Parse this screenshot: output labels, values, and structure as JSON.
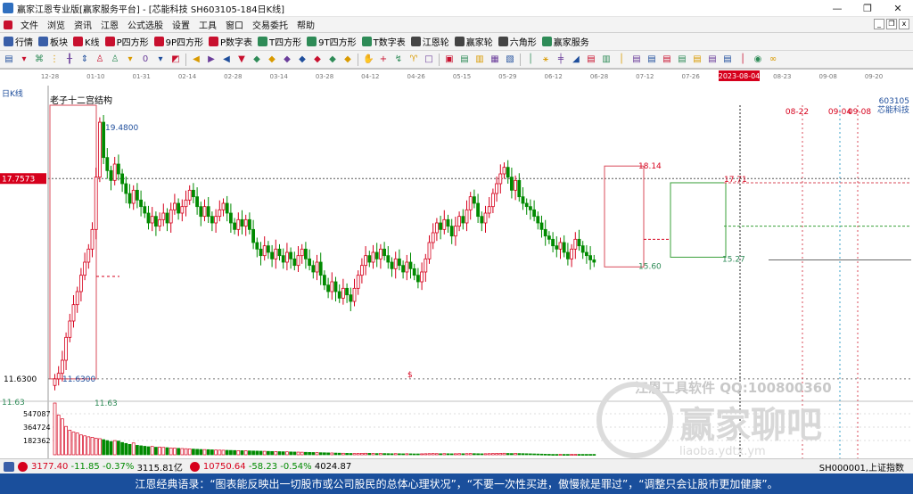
{
  "window": {
    "title": "赢家江恩专业版[赢家服务平台] - [芯能科技  SH603105-184日K线]",
    "controls": {
      "minimize": "—",
      "restore": "❐",
      "close": "✕"
    }
  },
  "menu": {
    "items": [
      "文件",
      "浏览",
      "资讯",
      "江恩",
      "公式选股",
      "设置",
      "工具",
      "窗口",
      "交易委托",
      "帮助"
    ],
    "right_controls": [
      "_",
      "❐",
      "x"
    ]
  },
  "toolbar": {
    "items": [
      {
        "label": "行情",
        "color": "#3a5fa8"
      },
      {
        "label": "板块",
        "color": "#3a5fa8"
      },
      {
        "label": "K线",
        "color": "#c8102e"
      },
      {
        "label": "P四方形",
        "color": "#c8102e"
      },
      {
        "label": "9P四方形",
        "color": "#c8102e"
      },
      {
        "label": "P数字表",
        "color": "#c8102e"
      },
      {
        "label": "T四方形",
        "color": "#2e8b57"
      },
      {
        "label": "9T四方形",
        "color": "#2e8b57"
      },
      {
        "label": "T数字表",
        "color": "#2e8b57"
      },
      {
        "label": "江恩轮",
        "color": "#444444"
      },
      {
        "label": "赢家轮",
        "color": "#444444"
      },
      {
        "label": "六角形",
        "color": "#444444"
      },
      {
        "label": "赢家服务",
        "color": "#2e8b57"
      }
    ]
  },
  "drawing_tools": [
    "▤",
    "▾",
    "⌘",
    "⋮",
    "╂",
    "⇕",
    "♙",
    "♙",
    "▾",
    "0",
    "▾",
    "◩",
    "|",
    "◀",
    "▶",
    "◀",
    "▼",
    "◆",
    "◆",
    "◆",
    "◆",
    "◆",
    "◆",
    "◆",
    "|",
    "✋",
    "+",
    "↯",
    "♈",
    "□",
    "|",
    "▣",
    "▤",
    "▥",
    "▦",
    "▧",
    "|",
    "│",
    "⚹",
    "╪",
    "◢",
    "▤",
    "▥",
    "│",
    "▤",
    "▤",
    "▤",
    "▤",
    "▤",
    "▤",
    "▤",
    "│",
    "◉",
    "∞"
  ],
  "chart_data": {
    "type": "candlestick",
    "period_label": "日K线",
    "stock_code": "603105",
    "stock_name": "芯能科技",
    "study_label": "老子十二宫结构",
    "x_dates": [
      "12-28",
      "01-10",
      "01-31",
      "02-14",
      "02-28",
      "03-14",
      "03-28",
      "04-12",
      "04-26",
      "05-15",
      "05-29",
      "06-12",
      "06-28",
      "07-12",
      "07-26",
      "2023-08-04",
      "08-23",
      "09-08",
      "09-20"
    ],
    "highlight_date": "2023-08-04",
    "future_markers": [
      "08-22",
      "09-04",
      "09-08"
    ],
    "price_high": 19.48,
    "price_low": 11.63,
    "cursor_price": "17.7573",
    "y_axis_labels": [
      "11.6300"
    ],
    "annotations": [
      "19.4800",
      "11.6300",
      "18.14",
      "17.71",
      "15.60",
      "15.27",
      "11.63",
      "$"
    ],
    "volume_labels": [
      "547087",
      "364724",
      "182362"
    ],
    "ylim": [
      11.0,
      20.0
    ],
    "closes": [
      11.63,
      11.8,
      12.2,
      12.9,
      13.4,
      13.9,
      14.3,
      14.8,
      15.2,
      15.6,
      16.2,
      17.8,
      19.48,
      18.4,
      18.0,
      17.7,
      18.2,
      17.9,
      17.6,
      17.3,
      17.0,
      17.4,
      17.1,
      16.9,
      16.7,
      16.4,
      16.6,
      16.3,
      16.5,
      16.7,
      16.4,
      16.8,
      17.0,
      16.7,
      16.9,
      17.1,
      17.4,
      17.2,
      16.9,
      16.6,
      16.9,
      16.6,
      16.4,
      16.6,
      16.8,
      17.0,
      16.7,
      16.4,
      16.2,
      16.5,
      16.3,
      16.5,
      16.2,
      15.8,
      15.6,
      15.4,
      15.7,
      15.5,
      15.3,
      15.6,
      15.4,
      15.2,
      15.5,
      15.3,
      15.1,
      15.4,
      15.6,
      15.3,
      15.1,
      14.9,
      15.2,
      14.8,
      14.5,
      14.3,
      14.6,
      14.3,
      14.1,
      14.4,
      14.2,
      14.0,
      14.4,
      14.8,
      15.1,
      15.4,
      15.2,
      15.5,
      15.3,
      15.6,
      15.4,
      15.2,
      15.0,
      15.3,
      15.1,
      14.9,
      15.2,
      15.0,
      14.8,
      14.6,
      14.9,
      15.3,
      15.8,
      16.1,
      16.4,
      16.2,
      16.5,
      16.3,
      16.0,
      16.3,
      16.6,
      16.4,
      16.8,
      17.2,
      17.0,
      16.6,
      16.4,
      16.7,
      16.9,
      17.3,
      17.6,
      17.9,
      18.1,
      17.8,
      17.4,
      17.7,
      17.2,
      17.0,
      16.9,
      16.8,
      16.6,
      16.4,
      16.2,
      16.0,
      15.9,
      15.7,
      15.6,
      15.8,
      15.5,
      15.3,
      15.6,
      15.9,
      15.7,
      15.5,
      15.4,
      15.27,
      15.2
    ],
    "volumes": [
      547087,
      420000,
      380000,
      300000,
      260000,
      240000,
      230000,
      210000,
      200000,
      190000,
      185000,
      175000,
      170000,
      160000,
      150000,
      140000,
      150000,
      145000,
      130000,
      120000,
      110000,
      125000,
      100000,
      95000,
      90000,
      85000,
      88000,
      80000,
      82000,
      78000,
      75000,
      72000,
      70000,
      68000,
      66000,
      64000,
      62000,
      60000,
      58000,
      56000,
      55000,
      54000,
      52000,
      50000,
      49000,
      48000,
      47000,
      46000,
      45000,
      44000,
      43000,
      42000,
      41000,
      40000,
      39000,
      38000,
      37000,
      36000,
      35000,
      34000,
      33000,
      32000,
      31000,
      30000,
      29000,
      28000,
      27000,
      26000,
      25000,
      24000,
      23000,
      22000,
      21000,
      20000,
      19000,
      18000,
      17000,
      16000,
      15000,
      14000,
      13000,
      14000,
      15000,
      16000,
      15000,
      14000,
      13000,
      14000,
      13000,
      12000,
      11000,
      12000,
      11000,
      10000,
      11000,
      10000,
      9000,
      9000,
      10000,
      11000,
      12000,
      13000,
      12000,
      11000,
      12000,
      11000,
      10000,
      11000,
      12000,
      11000,
      12000,
      13000,
      12000,
      11000,
      10000,
      11000,
      12000,
      13000,
      14000,
      15000,
      16000,
      14000,
      13000,
      14000,
      13000,
      12000,
      11000,
      10000,
      9000,
      8000,
      7000,
      6000,
      5000,
      4000,
      4000,
      4000,
      4000,
      4000,
      4000,
      4000,
      4000,
      4000,
      4000,
      4000,
      4000
    ],
    "watermark": "江恩工具软件 QQ:100800360",
    "watermark2": "赢家聊吧",
    "watermark3": "liaoba.ydtx.ym"
  },
  "status_bar": {
    "index1": {
      "value": "3177.40",
      "change": "-11.85",
      "pct": "-0.37%",
      "amount": "3115.81亿"
    },
    "index2": {
      "value": "10750.64",
      "change": "-58.23",
      "pct": "-0.54%",
      "amount": "4024.87"
    },
    "right_label": "SH000001,上证指数"
  },
  "quote": "江恩经典语录：“图表能反映出一切股市或公司股民的总体心理状况”，“不要一次性买进，傲慢就是罪过”，“调整只会让股市更加健康”。"
}
